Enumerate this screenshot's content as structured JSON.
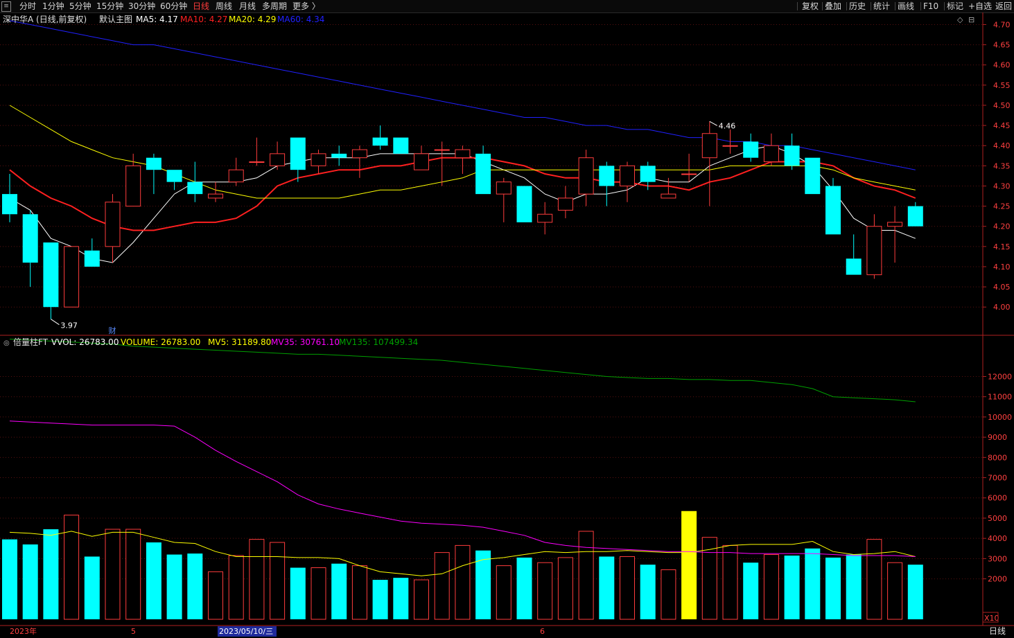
{
  "toolbar": {
    "left": [
      "分时",
      "1分钟",
      "5分钟",
      "15分钟",
      "30分钟",
      "60分钟",
      "日线",
      "周线",
      "月线",
      "多周期",
      "更多 〉"
    ],
    "active": "日线",
    "right": [
      "复权",
      "叠加",
      "历史",
      "统计",
      "画线",
      "F10",
      "标记",
      "+自选",
      "返回"
    ]
  },
  "main_header": {
    "title": "深中华A (日线,前复权)",
    "template": "默认主图",
    "ma": [
      {
        "label": "MA5: 4.17",
        "color": "#ffffff"
      },
      {
        "label": "MA10: 4.27",
        "color": "#ff2020"
      },
      {
        "label": "MA20: 4.29",
        "color": "#ffff00"
      },
      {
        "label": "MA60: 4.34",
        "color": "#2020ff"
      }
    ]
  },
  "volume_header": {
    "title": "倍量柱FT",
    "items": [
      {
        "label": "VVOL: 26783.00",
        "color": "#ffffff"
      },
      {
        "label": "VOLUME: 26783.00",
        "color": "#ffff00"
      },
      {
        "label": "MV5: 31189.80",
        "color": "#ffff00"
      },
      {
        "label": "MV35: 30761.10",
        "color": "#ff00ff"
      },
      {
        "label": "MV135: 107499.34",
        "color": "#00a000"
      }
    ]
  },
  "price_axis": {
    "ticks": [
      "4.70",
      "4.65",
      "4.60",
      "4.55",
      "4.50",
      "4.45",
      "4.40",
      "4.35",
      "4.30",
      "4.25",
      "4.20",
      "4.15",
      "4.10",
      "4.05",
      "4.00"
    ]
  },
  "volume_axis": {
    "ticks": [
      "12000",
      "11000",
      "10000",
      "9000",
      "8000",
      "7000",
      "6000",
      "5000",
      "4000",
      "3000",
      "2000"
    ],
    "unit": "X10"
  },
  "annotations": {
    "high": "4.46",
    "low": "3.97",
    "marker": "财"
  },
  "date_axis": {
    "labels": [
      "2023年",
      "5",
      "2023/05/10/三",
      "6"
    ]
  },
  "corner_label": "日线",
  "chart_data": {
    "type": "candlestick",
    "price_range": [
      3.93,
      4.73
    ],
    "volume_range": [
      0,
      13900
    ],
    "candles": [
      {
        "o": 4.28,
        "h": 4.33,
        "l": 4.21,
        "c": 4.23,
        "v": 3950
      },
      {
        "o": 4.23,
        "h": 4.24,
        "l": 4.05,
        "c": 4.11,
        "v": 3700
      },
      {
        "o": 4.16,
        "h": 4.16,
        "l": 3.97,
        "c": 4.0,
        "v": 4450
      },
      {
        "o": 4.0,
        "h": 4.15,
        "l": 4.0,
        "c": 4.15,
        "v": 5150
      },
      {
        "o": 4.14,
        "h": 4.17,
        "l": 4.1,
        "c": 4.1,
        "v": 3100
      },
      {
        "o": 4.15,
        "h": 4.28,
        "l": 4.11,
        "c": 4.26,
        "v": 4450
      },
      {
        "o": 4.25,
        "h": 4.38,
        "l": 4.25,
        "c": 4.35,
        "v": 4450
      },
      {
        "o": 4.37,
        "h": 4.38,
        "l": 4.28,
        "c": 4.34,
        "v": 3800
      },
      {
        "o": 4.34,
        "h": 4.34,
        "l": 4.29,
        "c": 4.31,
        "v": 3200
      },
      {
        "o": 4.31,
        "h": 4.36,
        "l": 4.26,
        "c": 4.28,
        "v": 3250
      },
      {
        "o": 4.27,
        "h": 4.31,
        "l": 4.26,
        "c": 4.28,
        "v": 2350
      },
      {
        "o": 4.31,
        "h": 4.37,
        "l": 4.3,
        "c": 4.34,
        "v": 3150
      },
      {
        "o": 4.36,
        "h": 4.42,
        "l": 4.35,
        "c": 4.36,
        "v": 3950
      },
      {
        "o": 4.35,
        "h": 4.41,
        "l": 4.34,
        "c": 4.38,
        "v": 3800
      },
      {
        "o": 4.42,
        "h": 4.42,
        "l": 4.31,
        "c": 4.34,
        "v": 2550
      },
      {
        "o": 4.35,
        "h": 4.39,
        "l": 4.33,
        "c": 4.38,
        "v": 2550
      },
      {
        "o": 4.38,
        "h": 4.4,
        "l": 4.35,
        "c": 4.37,
        "v": 2750
      },
      {
        "o": 4.37,
        "h": 4.4,
        "l": 4.32,
        "c": 4.39,
        "v": 2650
      },
      {
        "o": 4.42,
        "h": 4.45,
        "l": 4.39,
        "c": 4.4,
        "v": 1950
      },
      {
        "o": 4.42,
        "h": 4.42,
        "l": 4.38,
        "c": 4.38,
        "v": 2050
      },
      {
        "o": 4.34,
        "h": 4.4,
        "l": 4.34,
        "c": 4.38,
        "v": 1950
      },
      {
        "o": 4.39,
        "h": 4.41,
        "l": 4.3,
        "c": 4.39,
        "v": 3300
      },
      {
        "o": 4.37,
        "h": 4.4,
        "l": 4.33,
        "c": 4.39,
        "v": 3650
      },
      {
        "o": 4.38,
        "h": 4.4,
        "l": 4.28,
        "c": 4.28,
        "v": 3400
      },
      {
        "o": 4.28,
        "h": 4.32,
        "l": 4.21,
        "c": 4.31,
        "v": 2650
      },
      {
        "o": 4.3,
        "h": 4.3,
        "l": 4.21,
        "c": 4.21,
        "v": 3050
      },
      {
        "o": 4.21,
        "h": 4.26,
        "l": 4.18,
        "c": 4.23,
        "v": 2800
      },
      {
        "o": 4.24,
        "h": 4.3,
        "l": 4.22,
        "c": 4.27,
        "v": 3050
      },
      {
        "o": 4.28,
        "h": 4.39,
        "l": 4.25,
        "c": 4.37,
        "v": 4350
      },
      {
        "o": 4.35,
        "h": 4.36,
        "l": 4.25,
        "c": 4.3,
        "v": 3100
      },
      {
        "o": 4.3,
        "h": 4.36,
        "l": 4.26,
        "c": 4.35,
        "v": 3100
      },
      {
        "o": 4.35,
        "h": 4.36,
        "l": 4.29,
        "c": 4.31,
        "v": 2700
      },
      {
        "o": 4.27,
        "h": 4.32,
        "l": 4.27,
        "c": 4.28,
        "v": 2450
      },
      {
        "o": 4.33,
        "h": 4.38,
        "l": 4.31,
        "c": 4.33,
        "v": 5350
      },
      {
        "o": 4.37,
        "h": 4.46,
        "l": 4.25,
        "c": 4.43,
        "v": 4050
      },
      {
        "o": 4.4,
        "h": 4.44,
        "l": 4.38,
        "c": 4.4,
        "v": 3650
      },
      {
        "o": 4.41,
        "h": 4.43,
        "l": 4.36,
        "c": 4.37,
        "v": 2800
      },
      {
        "o": 4.36,
        "h": 4.43,
        "l": 4.35,
        "c": 4.4,
        "v": 3200
      },
      {
        "o": 4.4,
        "h": 4.43,
        "l": 4.34,
        "c": 4.35,
        "v": 3150
      },
      {
        "o": 4.37,
        "h": 4.37,
        "l": 4.28,
        "c": 4.28,
        "v": 3500
      },
      {
        "o": 4.3,
        "h": 4.32,
        "l": 4.18,
        "c": 4.18,
        "v": 3050
      },
      {
        "o": 4.12,
        "h": 4.18,
        "l": 4.08,
        "c": 4.08,
        "v": 3200
      },
      {
        "o": 4.08,
        "h": 4.23,
        "l": 4.07,
        "c": 4.2,
        "v": 3950
      },
      {
        "o": 4.2,
        "h": 4.25,
        "l": 4.11,
        "c": 4.21,
        "v": 2800
      },
      {
        "o": 4.25,
        "h": 4.26,
        "l": 4.2,
        "c": 4.2,
        "v": 2700
      }
    ],
    "highlight_volume_index": 33,
    "ma_series": [
      {
        "name": "MA5",
        "color": "#ffffff",
        "values": [
          4.27,
          4.24,
          4.17,
          4.15,
          4.12,
          4.11,
          4.16,
          4.22,
          4.28,
          4.31,
          4.31,
          4.31,
          4.32,
          4.35,
          4.36,
          4.37,
          4.37,
          4.37,
          4.38,
          4.38,
          4.38,
          4.38,
          4.38,
          4.36,
          4.34,
          4.32,
          4.28,
          4.26,
          4.28,
          4.28,
          4.29,
          4.32,
          4.31,
          4.31,
          4.35,
          4.37,
          4.39,
          4.4,
          4.38,
          4.35,
          4.29,
          4.22,
          4.19,
          4.19,
          4.17
        ]
      },
      {
        "name": "MA10",
        "color": "#ff2020",
        "values": [
          4.34,
          4.3,
          4.27,
          4.25,
          4.22,
          4.2,
          4.19,
          4.19,
          4.2,
          4.21,
          4.21,
          4.22,
          4.25,
          4.3,
          4.32,
          4.33,
          4.34,
          4.34,
          4.35,
          4.35,
          4.36,
          4.37,
          4.37,
          4.37,
          4.36,
          4.35,
          4.33,
          4.32,
          4.32,
          4.31,
          4.31,
          4.3,
          4.3,
          4.29,
          4.31,
          4.32,
          4.34,
          4.36,
          4.36,
          4.36,
          4.35,
          4.32,
          4.3,
          4.29,
          4.27
        ]
      },
      {
        "name": "MA20",
        "color": "#ffff00",
        "values": [
          4.5,
          4.47,
          4.44,
          4.41,
          4.39,
          4.37,
          4.36,
          4.35,
          4.33,
          4.31,
          4.29,
          4.28,
          4.27,
          4.27,
          4.27,
          4.27,
          4.27,
          4.28,
          4.29,
          4.29,
          4.3,
          4.31,
          4.32,
          4.34,
          4.34,
          4.34,
          4.34,
          4.34,
          4.34,
          4.34,
          4.34,
          4.34,
          4.34,
          4.34,
          4.34,
          4.35,
          4.35,
          4.35,
          4.35,
          4.35,
          4.34,
          4.32,
          4.31,
          4.3,
          4.29
        ]
      },
      {
        "name": "MA60",
        "color": "#2020ff",
        "values": [
          4.71,
          4.7,
          4.69,
          4.68,
          4.67,
          4.66,
          4.65,
          4.65,
          4.64,
          4.63,
          4.62,
          4.61,
          4.6,
          4.59,
          4.58,
          4.57,
          4.56,
          4.55,
          4.54,
          4.53,
          4.52,
          4.51,
          4.5,
          4.49,
          4.48,
          4.47,
          4.47,
          4.46,
          4.45,
          4.45,
          4.44,
          4.44,
          4.43,
          4.42,
          4.42,
          4.41,
          4.41,
          4.4,
          4.4,
          4.39,
          4.38,
          4.37,
          4.36,
          4.35,
          4.34
        ]
      }
    ],
    "volume_lines": [
      {
        "name": "MV5",
        "color": "#ffff00",
        "values": [
          4300,
          4250,
          4150,
          4350,
          4100,
          4300,
          4300,
          4050,
          3800,
          3750,
          3350,
          3100,
          3100,
          3100,
          3050,
          3050,
          3000,
          2650,
          2350,
          2250,
          2150,
          2250,
          2650,
          2950,
          3050,
          3200,
          3350,
          3300,
          3350,
          3350,
          3400,
          3350,
          3300,
          3300,
          3450,
          3650,
          3700,
          3700,
          3700,
          3850,
          3350,
          3200,
          3250,
          3350,
          3100
        ]
      },
      {
        "name": "MV35",
        "color": "#ff00ff",
        "values": [
          9800,
          9750,
          9700,
          9650,
          9600,
          9600,
          9600,
          9600,
          9550,
          9000,
          8350,
          7800,
          7300,
          6800,
          6150,
          5700,
          5450,
          5250,
          5050,
          4850,
          4750,
          4700,
          4650,
          4550,
          4350,
          4150,
          3800,
          3650,
          3550,
          3500,
          3450,
          3400,
          3350,
          3350,
          3300,
          3300,
          3250,
          3250,
          3250,
          3250,
          3200,
          3150,
          3150,
          3150,
          3100
        ]
      },
      {
        "name": "MV135",
        "color": "#00a000",
        "values": [
          13850,
          13800,
          13750,
          13700,
          13650,
          13600,
          13500,
          13450,
          13400,
          13350,
          13300,
          13250,
          13200,
          13150,
          13100,
          13100,
          13050,
          13000,
          12950,
          12900,
          12850,
          12800,
          12700,
          12600,
          12500,
          12400,
          12300,
          12200,
          12100,
          12000,
          11950,
          11900,
          11900,
          11850,
          11850,
          11800,
          11800,
          11700,
          11600,
          11400,
          11000,
          10950,
          10900,
          10850,
          10750
        ]
      }
    ]
  }
}
